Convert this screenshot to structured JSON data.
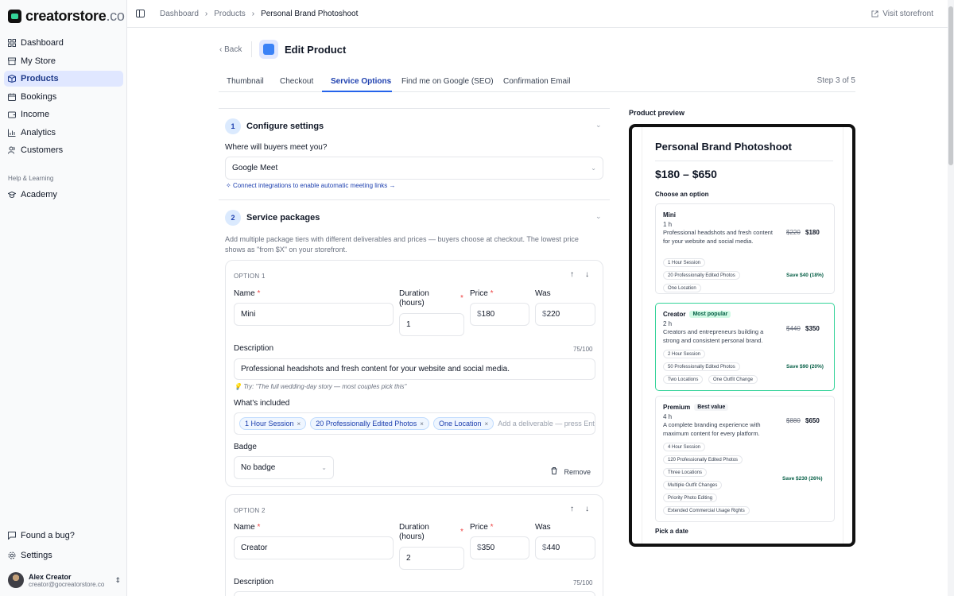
{
  "app": {
    "logo_main": "creatorstore",
    "logo_tld": ".co"
  },
  "sidebar": {
    "items": [
      {
        "label": "Dashboard",
        "icon": "grid-icon"
      },
      {
        "label": "My Store",
        "icon": "store-icon"
      },
      {
        "label": "Products",
        "icon": "box-icon",
        "active": true
      },
      {
        "label": "Bookings",
        "icon": "calendar-icon"
      },
      {
        "label": "Income",
        "icon": "wallet-icon"
      },
      {
        "label": "Analytics",
        "icon": "chart-icon"
      },
      {
        "label": "Customers",
        "icon": "users-icon"
      }
    ],
    "section_label": "Help & Learning",
    "academy": "Academy",
    "bug": "Found a bug?",
    "settings": "Settings",
    "user": {
      "name": "Alex Creator",
      "email": "creator@gocreatorstore.co"
    }
  },
  "topbar": {
    "crumbs": [
      "Dashboard",
      "Products",
      "Personal Brand Photoshoot"
    ],
    "visit": "Visit storefront"
  },
  "header": {
    "back": "Back",
    "title": "Edit Product",
    "tabs": [
      "Thumbnail",
      "Checkout",
      "Service Options",
      "Find me on Google (SEO)",
      "Confirmation Email"
    ],
    "active_tab": "Service Options",
    "step": "Step 3 of 5"
  },
  "section1": {
    "num": "1",
    "title": "Configure settings",
    "question": "Where will buyers meet you?",
    "meeting": "Google Meet",
    "link": "Connect integrations to enable automatic meeting links →"
  },
  "section2": {
    "num": "2",
    "title": "Service packages",
    "description": "Add multiple package tiers with different deliverables and prices — buyers choose at checkout. The lowest price shows as \"from $X\" on your storefront."
  },
  "labels": {
    "name": "Name",
    "duration": "Duration (hours)",
    "price": "Price",
    "was": "Was",
    "description": "Description",
    "included": "What's included",
    "badge": "Badge",
    "remove": "Remove",
    "add_placeholder": "Add a deliverable — press Enter",
    "currency": "$",
    "req": "*"
  },
  "options": [
    {
      "header": "OPTION 1",
      "name": "Mini",
      "duration": "1",
      "price": "180",
      "was": "220",
      "description": "Professional headshots and fresh content for your website and social media.",
      "counter": "75/100",
      "tip": "Try: \"The full wedding-day story — most couples pick this\"",
      "included": [
        "1 Hour Session",
        "20 Professionally Edited Photos",
        "One Location"
      ],
      "badge": "No badge"
    },
    {
      "header": "OPTION 2",
      "name": "Creator",
      "duration": "2",
      "price": "350",
      "was": "440",
      "counter": "75/100"
    }
  ],
  "preview": {
    "label": "Product preview",
    "title": "Personal Brand Photoshoot",
    "price_range": "$180 – $650",
    "choose": "Choose an option",
    "pick_date": "Pick a date",
    "cards": [
      {
        "name": "Mini",
        "tag": "",
        "duration": "1 h",
        "desc": "Professional headshots and fresh content for your website and social media.",
        "was": "$220",
        "now": "$180",
        "save": "Save $40 (18%)",
        "pills": [
          "1 Hour Session",
          "20 Professionally Edited Photos",
          "One Location"
        ]
      },
      {
        "name": "Creator",
        "tag": "Most popular",
        "duration": "2 h",
        "desc": "Creators and entrepreneurs building a strong and consistent personal brand.",
        "was": "$440",
        "now": "$350",
        "save": "Save $90 (20%)",
        "pills": [
          "2 Hour Session",
          "50 Professionally Edited Photos",
          "Two Locations",
          "One Outfit Change"
        ]
      },
      {
        "name": "Premium",
        "tag": "Best value",
        "duration": "4 h",
        "desc": "A complete branding experience with maximum content for every platform.",
        "was": "$880",
        "now": "$650",
        "save": "Save $230 (26%)",
        "pills": [
          "4 Hour Session",
          "120 Professionally Edited Photos",
          "Three Locations",
          "Multiple Outfit Changes",
          "Priority Photo Editing",
          "Extended Commercial Usage Rights"
        ]
      }
    ]
  },
  "colors": {
    "accent": "#2563eb",
    "active_bg": "#e0e7ff",
    "popular": "#34d399"
  }
}
